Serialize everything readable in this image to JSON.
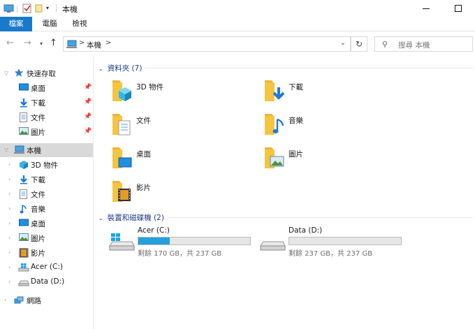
{
  "window": {
    "title": "本機"
  },
  "ribbon": {
    "tabs": [
      "檔案",
      "電腦",
      "檢視"
    ]
  },
  "address": {
    "crumb": "本機",
    "separator": ">",
    "search_placeholder": "搜尋 本機"
  },
  "navpane": {
    "quick_access": "快速存取",
    "quick_items": [
      "桌面",
      "下載",
      "文件",
      "圖片"
    ],
    "this_pc": "本機",
    "pc_items": [
      "3D 物件",
      "下載",
      "文件",
      "音樂",
      "桌面",
      "圖片",
      "影片",
      "Acer (C:)",
      "Data (D:)"
    ],
    "network": "網路"
  },
  "content": {
    "folders_header": "資料夾 (7)",
    "folders": [
      "3D 物件",
      "下載",
      "文件",
      "音樂",
      "桌面",
      "圖片",
      "影片"
    ],
    "drives_header": "裝置和磁碟機 (2)",
    "drives": [
      {
        "name": "Acer (C:)",
        "free": "剩餘 170 GB，共 237 GB",
        "used_fraction": 0.28
      },
      {
        "name": "Data (D:)",
        "free": "剩餘 237 GB，共 237 GB",
        "used_fraction": 0.0
      }
    ]
  },
  "colors": {
    "accent": "#1979ca",
    "folder": "#f5c542",
    "bar_fill": "#26a0da",
    "header_text": "#1e3c8c"
  }
}
